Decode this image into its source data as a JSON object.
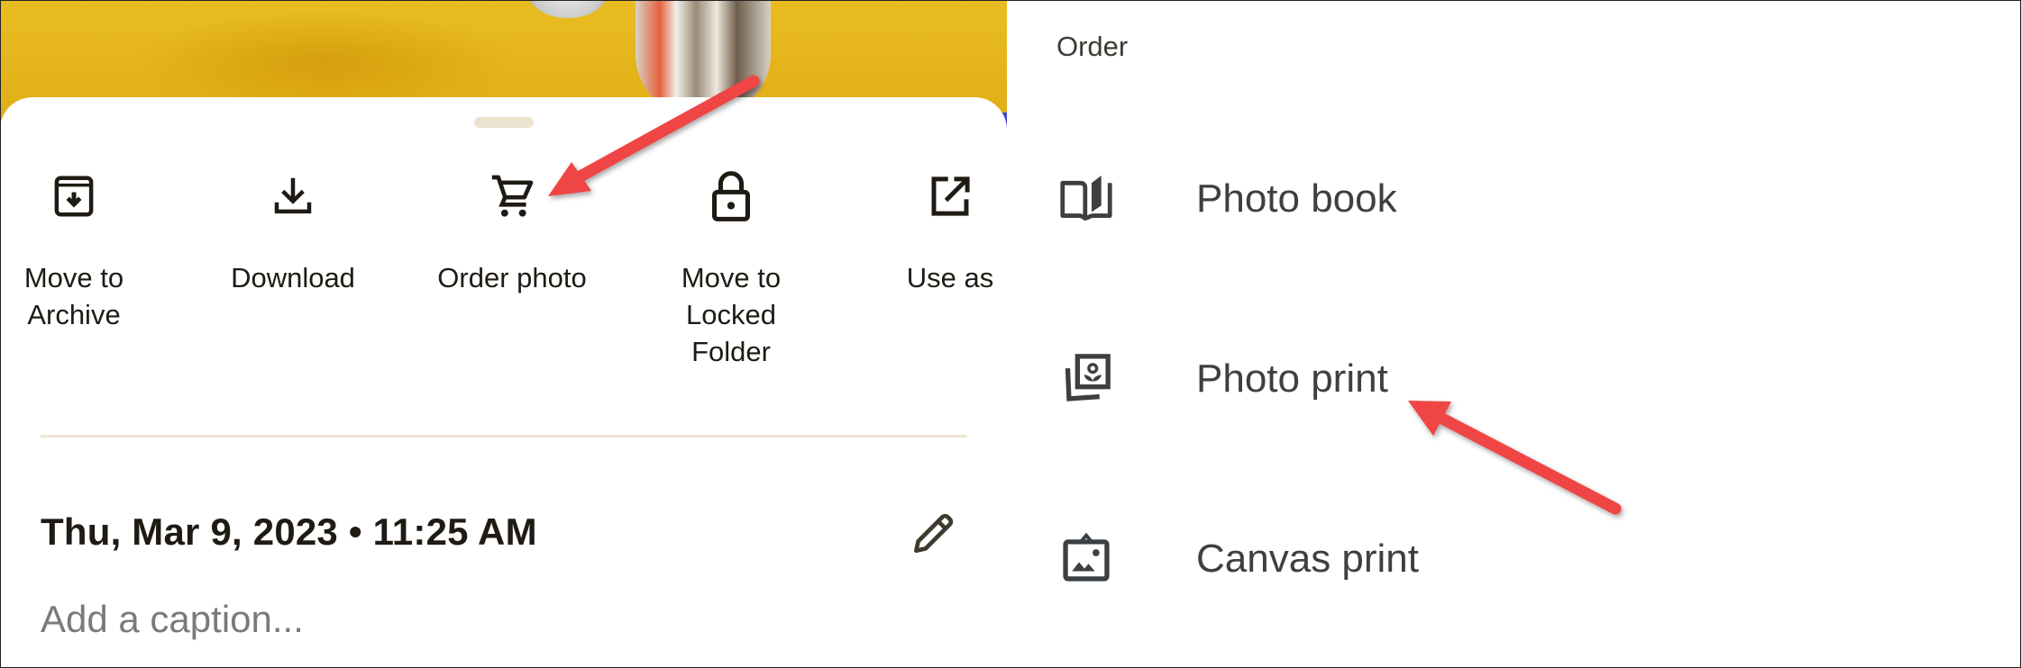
{
  "left_panel": {
    "photo": {
      "description": "Yellow photo with figurine (partially visible)"
    },
    "actions": [
      {
        "id": "archive",
        "label": "Move to\nArchive",
        "icon": "archive-icon"
      },
      {
        "id": "download",
        "label": "Download",
        "icon": "download-icon"
      },
      {
        "id": "order",
        "label": "Order photo",
        "icon": "shopping-cart-icon"
      },
      {
        "id": "locked",
        "label": "Move to\nLocked\nFolder",
        "icon": "lock-icon"
      },
      {
        "id": "use-as",
        "label": "Use as",
        "icon": "open-in-new-icon"
      }
    ],
    "date_time": "Thu, Mar 9, 2023  •  11:25 AM",
    "caption": {
      "value": "",
      "placeholder": "Add a caption..."
    },
    "edit_icon": "pencil-icon"
  },
  "right_panel": {
    "title": "Order",
    "items": [
      {
        "id": "photo-book",
        "label": "Photo book",
        "icon": "photo-book-icon"
      },
      {
        "id": "photo-print",
        "label": "Photo print",
        "icon": "photo-print-icon"
      },
      {
        "id": "canvas-print",
        "label": "Canvas print",
        "icon": "canvas-print-icon"
      }
    ]
  },
  "annotations": {
    "arrow_color": "#F04444",
    "arrows": [
      {
        "points_to": "Order photo"
      },
      {
        "points_to": "Photo print"
      }
    ]
  },
  "colors": {
    "icon_dark": "#1f1b14",
    "menu_icon": "#3c4043",
    "divider": "#eee5d5",
    "handle": "#ece3cf",
    "caption_placeholder": "#7a7a7a",
    "photo_yellow": "#e3b21a"
  }
}
